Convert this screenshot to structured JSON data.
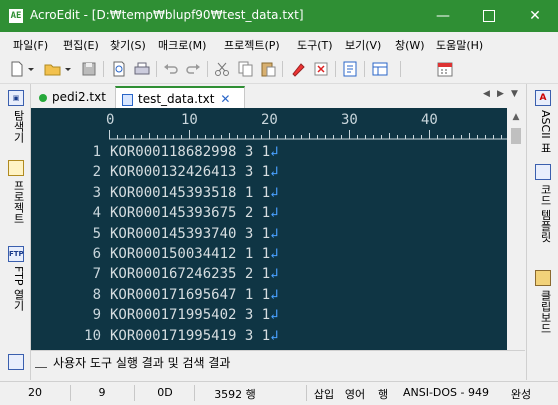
{
  "window": {
    "title": "AcroEdit - [D:₩temp₩blupf90₩test_data.txt]",
    "app_icon": "AE"
  },
  "menu": [
    "파일(F)",
    "편집(E)",
    "찾기(S)",
    "매크로(M)",
    "프로젝트(P)",
    "도구(T)",
    "보기(V)",
    "창(W)",
    "도움말(H)"
  ],
  "toolbar_icons": [
    "new-file-icon",
    "open-folder-icon",
    "save-icon",
    "print-preview-icon",
    "print-icon",
    "undo-icon",
    "redo-icon",
    "cut-icon",
    "copy-icon",
    "paste-icon",
    "highlight-icon",
    "clear-icon",
    "document-icon",
    "view-icon",
    "calendar-icon"
  ],
  "left_panel": [
    {
      "icon": "explorer-icon",
      "label": "탐색기"
    },
    {
      "icon": "project-icon",
      "label": "프로젝트"
    },
    {
      "icon": "ftp-icon",
      "badge": "FTP",
      "label": "FTP 열기"
    }
  ],
  "right_panel": [
    {
      "icon": "ascii-icon",
      "badge": "A",
      "label": "ASCII 표"
    },
    {
      "icon": "code-template-icon",
      "label": "코드 템플릿"
    },
    {
      "icon": "clipboard-icon",
      "label": "클립보드"
    }
  ],
  "tabs": [
    {
      "label": "pedi2.txt",
      "active": false
    },
    {
      "label": "test_data.txt",
      "active": true
    }
  ],
  "ruler": [
    "0",
    "10",
    "20",
    "30",
    "40"
  ],
  "editor": {
    "lines": [
      {
        "num": "1",
        "text": "KOR000118682998 3 1"
      },
      {
        "num": "2",
        "text": "KOR000132426413 3 1"
      },
      {
        "num": "3",
        "text": "KOR000145393518 1 1"
      },
      {
        "num": "4",
        "text": "KOR000145393675 2 1"
      },
      {
        "num": "5",
        "text": "KOR000145393740 3 1"
      },
      {
        "num": "6",
        "text": "KOR000150034412 1 1"
      },
      {
        "num": "7",
        "text": "KOR000167246235 2 1"
      },
      {
        "num": "8",
        "text": "KOR000171695647 1 1"
      },
      {
        "num": "9",
        "text": "KOR000171995402 3 1"
      },
      {
        "num": "10",
        "text": "KOR000171995419 3 1"
      }
    ],
    "newline_mark": "↲"
  },
  "output_tab": "사용자 도구 실행 결과 및 검색 결과",
  "status": {
    "line": "20",
    "column": "9",
    "char_code": "0D",
    "line_count": "3592 행",
    "insert_mode": "삽입",
    "language": "영어",
    "mode": "행",
    "encoding": "ANSI-DOS - 949",
    "state": "완성"
  }
}
